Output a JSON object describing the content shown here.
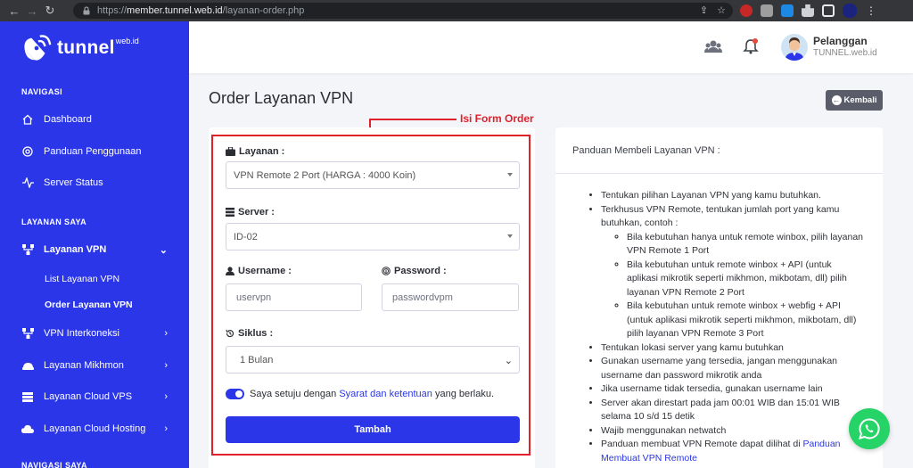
{
  "browser": {
    "url_prefix": "https://",
    "url_host": "member.tunnel.web.id",
    "url_path": "/layanan-order.php"
  },
  "brand": {
    "name": "tunnel",
    "suffix": "web.id"
  },
  "sidebar": {
    "heading_nav": "NAVIGASI",
    "heading_services": "LAYANAN SAYA",
    "heading_bottom": "NAVIGASI SAYA",
    "items": [
      {
        "label": "Dashboard",
        "icon": "home-icon"
      },
      {
        "label": "Panduan Penggunaan",
        "icon": "lifebuoy-icon"
      },
      {
        "label": "Server Status",
        "icon": "pulse-icon"
      },
      {
        "label": "Layanan VPN",
        "icon": "network-icon"
      },
      {
        "label": "VPN Interkoneksi",
        "icon": "network-icon"
      },
      {
        "label": "Layanan Mikhmon",
        "icon": "router-icon"
      },
      {
        "label": "Layanan Cloud VPS",
        "icon": "server-icon"
      },
      {
        "label": "Layanan Cloud Hosting",
        "icon": "cloud-icon"
      }
    ],
    "sub_items": [
      {
        "label": "List Layanan VPN"
      },
      {
        "label": "Order Layanan VPN"
      }
    ]
  },
  "header": {
    "user_name": "Pelanggan",
    "user_sub": "TUNNEL.web.id"
  },
  "page": {
    "title": "Order Layanan VPN",
    "back_label": "Kembali",
    "annotation": "Isi Form Order"
  },
  "form": {
    "layanan_label": "Layanan :",
    "layanan_value": "VPN Remote 2 Port (HARGA : 4000 Koin)",
    "server_label": "Server :",
    "server_value": "ID-02",
    "username_label": "Username :",
    "username_value": "uservpn",
    "password_label": "Password :",
    "password_value": "passwordvpm",
    "siklus_label": "Siklus :",
    "siklus_value": "1 Bulan",
    "agree_prefix": "Saya setuju dengan",
    "agree_link": "Syarat dan ketentuan",
    "agree_suffix": "yang berlaku.",
    "submit_label": "Tambah"
  },
  "guide": {
    "title": "Panduan Membeli Layanan VPN :",
    "items": [
      "Tentukan pilihan Layanan VPN yang kamu butuhkan.",
      "Terkhusus VPN Remote, tentukan jumlah port yang kamu butuhkan, contoh :",
      "Tentukan lokasi server yang kamu butuhkan",
      "Gunakan username yang tersedia, jangan menggunakan username dan password mikrotik anda",
      "Jika username tidak tersedia, gunakan username lain",
      "Server akan direstart pada jam 00:01 WIB dan 15:01 WIB selama 10 s/d 15 detik",
      "Wajib menggunakan netwatch"
    ],
    "sub_items": [
      "Bila kebutuhan hanya untuk remote winbox, pilih layanan VPN Remote 1 Port",
      "Bila kebutuhan untuk remote winbox + API (untuk aplikasi mikrotik seperti mikhmon, mikbotam, dll) pilih layanan VPN Remote 2 Port",
      "Bila kebutuhan untuk remote winbox + webfig + API (untuk aplikasi mikrotik seperti mikhmon, mikbotam, dll) pilih layanan VPN Remote 3 Port"
    ],
    "last_item_text": "Panduan membuat VPN Remote dapat dilihat di",
    "last_item_link": "Panduan Membuat VPN Remote"
  },
  "colors": {
    "primary": "#2a36e8",
    "annotation": "#e0202b",
    "whatsapp": "#25d366"
  }
}
